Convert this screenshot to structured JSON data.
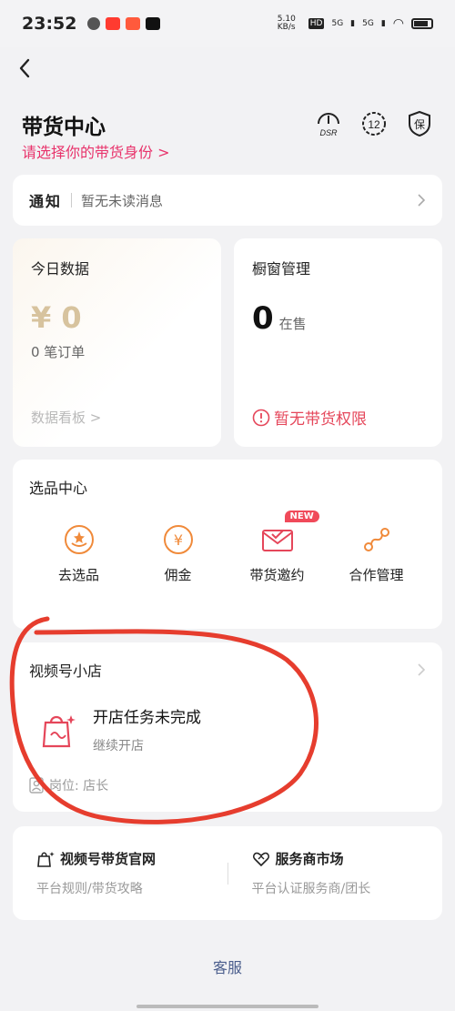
{
  "status_bar": {
    "time": "23:52",
    "net_speed": "5.10 KB/s",
    "hd": "HD",
    "sig1": "5G",
    "sig2": "5G"
  },
  "header": {
    "title": "带货中心",
    "identity_link": "请选择你的带货身份 >",
    "icons": [
      "speedometer-icon",
      "number-badge-icon",
      "shield-icon"
    ],
    "dsr_label": "DSR",
    "badge_number": "12",
    "shield_label": "保"
  },
  "notice": {
    "label": "通知",
    "text": "暂无未读消息"
  },
  "today_data": {
    "title": "今日数据",
    "amount": "¥ 0",
    "orders": "0 笔订单",
    "dashboard_link": "数据看板 >"
  },
  "window_mgmt": {
    "title": "橱窗管理",
    "count": "0",
    "unit": "在售",
    "no_permission": "暂无带货权限"
  },
  "selection_center": {
    "title": "选品中心",
    "items": [
      {
        "label": "去选品",
        "icon": "gift-icon"
      },
      {
        "label": "佣金",
        "icon": "yen-icon"
      },
      {
        "label": "带货邀约",
        "icon": "mail-icon",
        "badge": "NEW"
      },
      {
        "label": "合作管理",
        "icon": "link-icon"
      }
    ]
  },
  "shop": {
    "title": "视频号小店",
    "task": "开店任务未完成",
    "continue": "继续开店",
    "role": "岗位: 店长"
  },
  "links": [
    {
      "title": "视频号带货官网",
      "sub": "平台规则/带货攻略",
      "icon": "store-icon"
    },
    {
      "title": "服务商市场",
      "sub": "平台认证服务商/团长",
      "icon": "handshake-icon"
    }
  ],
  "customer_service": "客服",
  "colors": {
    "accent_pink": "#e8336b",
    "warning_red": "#e5465a",
    "orange": "#f08a3a",
    "annotation": "#e63d2e"
  }
}
